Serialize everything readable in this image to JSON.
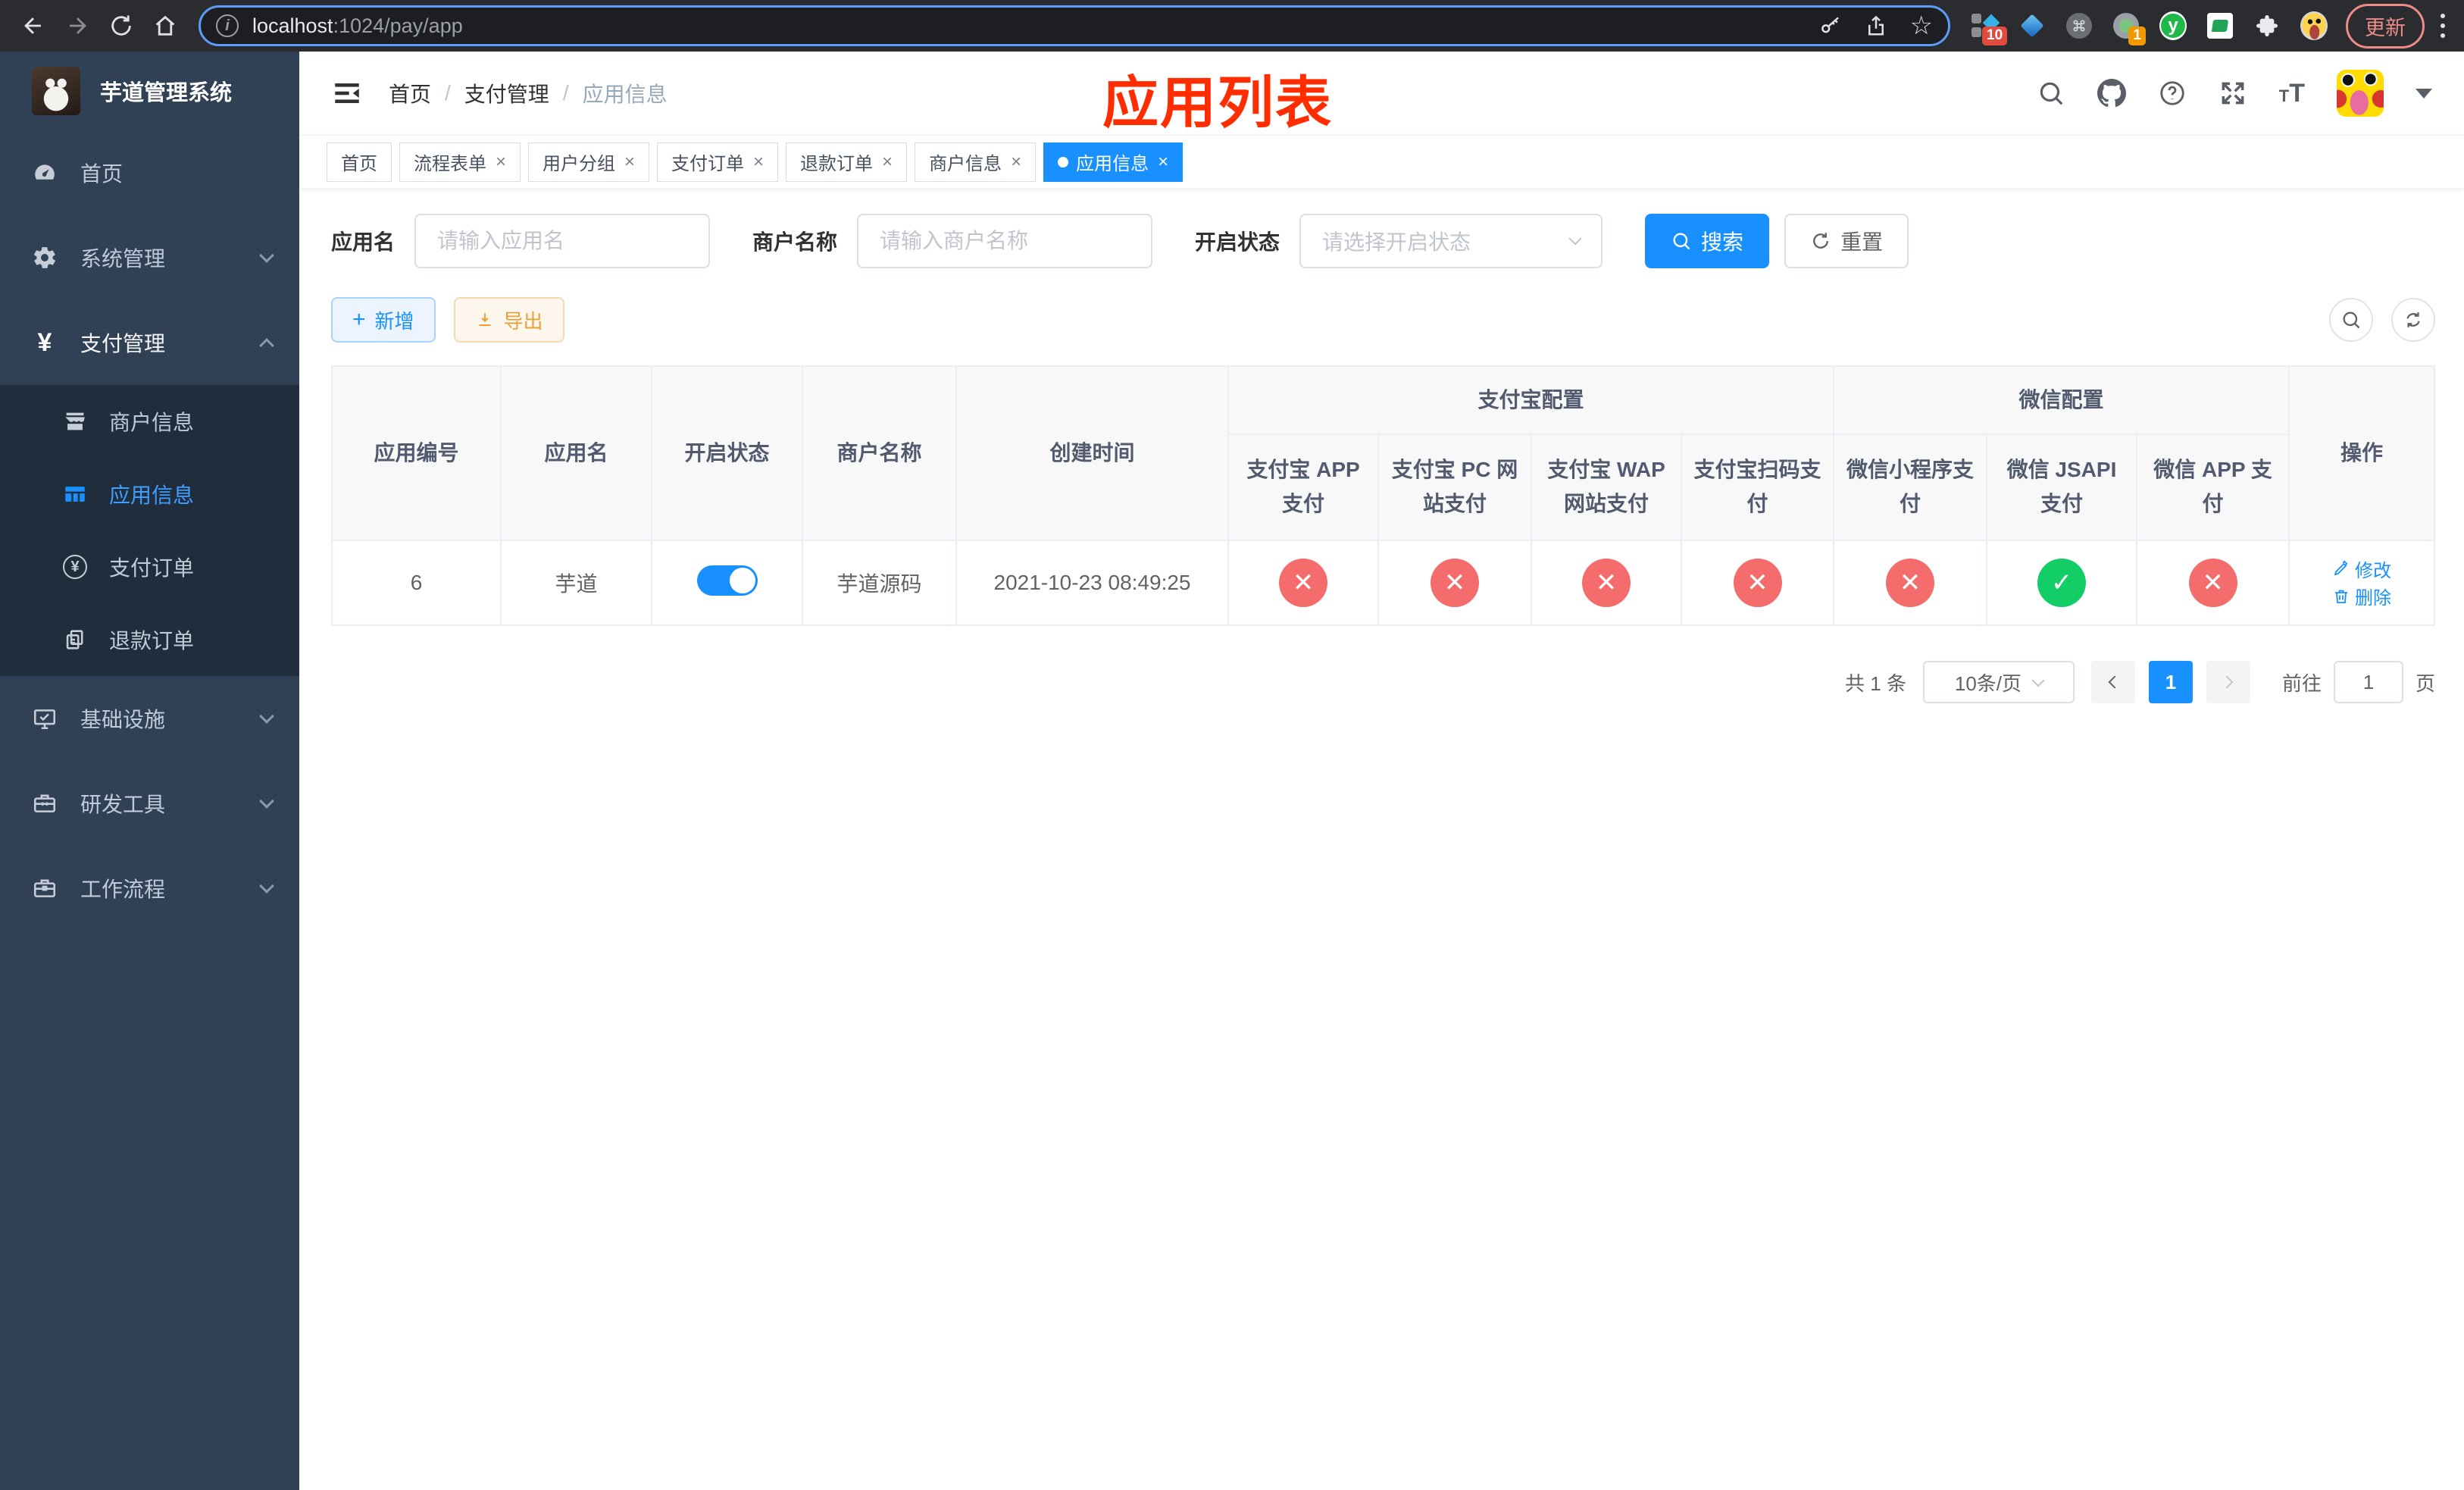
{
  "browser": {
    "url_host": "localhost",
    "url_path": ":1024/pay/app",
    "update_label": "更新",
    "ext1_badge": "10",
    "ext2_badge": "1",
    "y_letter": "y"
  },
  "icons": {
    "yen": "¥",
    "question": "?",
    "plus": "+",
    "star": "☆",
    "info": "i",
    "t_small": "T",
    "t_large": "T"
  },
  "sidebar": {
    "title": "芋道管理系统",
    "menu": [
      {
        "label": "首页"
      },
      {
        "label": "系统管理"
      },
      {
        "label": "支付管理"
      }
    ],
    "submenu": [
      {
        "label": "商户信息"
      },
      {
        "label": "应用信息"
      },
      {
        "label": "支付订单"
      },
      {
        "label": "退款订单"
      }
    ],
    "menu2": [
      {
        "label": "基础设施"
      },
      {
        "label": "研发工具"
      },
      {
        "label": "工作流程"
      }
    ]
  },
  "navbar": {
    "breadcrumb": {
      "items": [
        "首页",
        "支付管理",
        "应用信息"
      ],
      "separator": "/"
    },
    "annotation": "应用列表"
  },
  "tabs": [
    {
      "label": "首页"
    },
    {
      "label": "流程表单"
    },
    {
      "label": "用户分组"
    },
    {
      "label": "支付订单"
    },
    {
      "label": "退款订单"
    },
    {
      "label": "商户信息"
    },
    {
      "label": "应用信息"
    }
  ],
  "tab_close": "×",
  "filters": {
    "app_name_label": "应用名",
    "app_name_placeholder": "请输入应用名",
    "merchant_label": "商户名称",
    "merchant_placeholder": "请输入商户名称",
    "status_label": "开启状态",
    "status_placeholder": "请选择开启状态",
    "search_label": "搜索",
    "reset_label": "重置"
  },
  "toolbar": {
    "add_label": "新增",
    "export_label": "导出"
  },
  "table": {
    "col_headers": [
      "应用编号",
      "应用名",
      "开启状态",
      "商户名称",
      "创建时间"
    ],
    "group_alipay": "支付宝配置",
    "group_wechat": "微信配置",
    "sub_headers": [
      "支付宝 APP 支付",
      "支付宝 PC 网站支付",
      "支付宝 WAP 网站支付",
      "支付宝扫码支付",
      "微信小程序支付",
      "微信 JSAPI 支付",
      "微信 APP 支付"
    ],
    "action_header": "操作",
    "row": {
      "id": "6",
      "name": "芋道",
      "switch_state": "on",
      "merchant": "芋道源码",
      "created_at": "2021-10-23 08:49:25",
      "statuses": [
        {
          "state": "no",
          "glyph": "✕"
        },
        {
          "state": "no",
          "glyph": "✕"
        },
        {
          "state": "no",
          "glyph": "✕"
        },
        {
          "state": "no",
          "glyph": "✕"
        },
        {
          "state": "no",
          "glyph": "✕"
        },
        {
          "state": "yes",
          "glyph": "✓"
        },
        {
          "state": "no",
          "glyph": "✕"
        }
      ]
    },
    "actions": {
      "edit": "修改",
      "delete": "删除"
    }
  },
  "pagination": {
    "total": "共 1 条",
    "page_size": "10条/页",
    "current_page": "1",
    "goto_label": "前往",
    "goto_value": "1",
    "goto_suffix": "页"
  },
  "colors": {
    "primary": "#1890ff",
    "success": "#13ce66",
    "danger": "#f56c6c",
    "warning": "#e6a23c",
    "annotation": "#ff2d00",
    "sidebar_bg": "#304156",
    "submenu_bg": "#1f2d3d"
  }
}
